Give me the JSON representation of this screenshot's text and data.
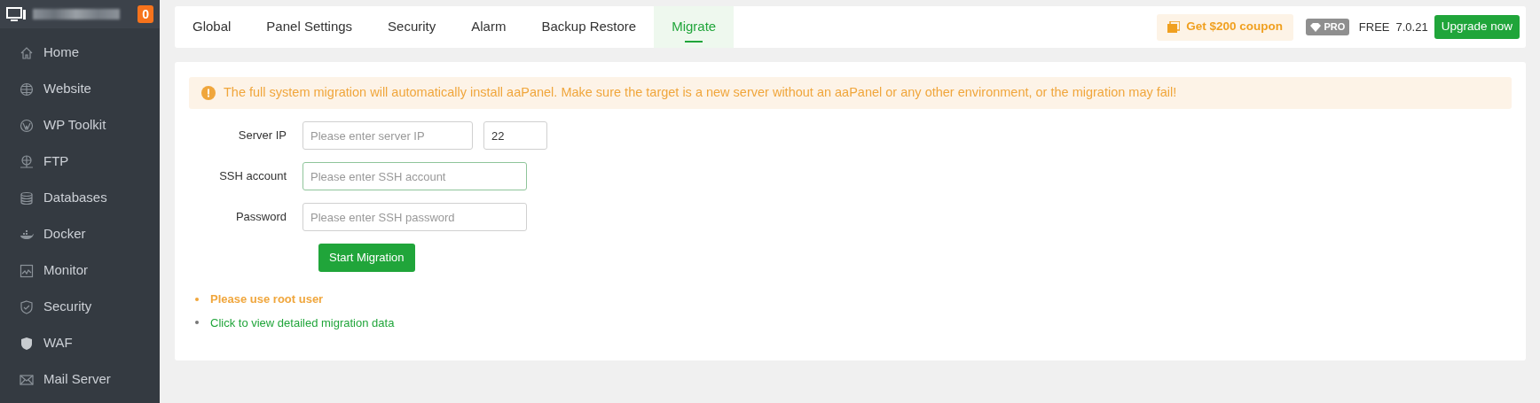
{
  "sidebar": {
    "badge": "0",
    "items": [
      {
        "label": "Home"
      },
      {
        "label": "Website"
      },
      {
        "label": "WP Toolkit"
      },
      {
        "label": "FTP"
      },
      {
        "label": "Databases"
      },
      {
        "label": "Docker"
      },
      {
        "label": "Monitor"
      },
      {
        "label": "Security"
      },
      {
        "label": "WAF"
      },
      {
        "label": "Mail Server"
      }
    ]
  },
  "tabs": [
    {
      "label": "Global",
      "selected": false
    },
    {
      "label": "Panel Settings",
      "selected": false
    },
    {
      "label": "Security",
      "selected": false
    },
    {
      "label": "Alarm",
      "selected": false
    },
    {
      "label": "Backup Restore",
      "selected": false
    },
    {
      "label": "Migrate",
      "selected": true
    }
  ],
  "header": {
    "coupon": "Get $200 coupon",
    "pro": "PRO",
    "plan": "FREE",
    "version": "7.0.21",
    "upgrade": "Upgrade now"
  },
  "alert": "The full system migration will automatically install aaPanel. Make sure the target is a new server without an aaPanel or any other environment, or the migration may fail!",
  "form": {
    "rows": [
      {
        "label": "Server IP",
        "fields": [
          {
            "placeholder": "Please enter server IP",
            "focused": false
          },
          {
            "value": "22",
            "focused": false
          }
        ]
      },
      {
        "label": "SSH account",
        "fields": [
          {
            "placeholder": "Please enter SSH account",
            "focused": true
          }
        ]
      },
      {
        "label": "Password",
        "fields": [
          {
            "placeholder": "Please enter SSH password",
            "focused": false
          }
        ]
      }
    ],
    "button": "Start Migration"
  },
  "notes": [
    {
      "kind": "warning",
      "text": "Please use root user"
    },
    {
      "kind": "link",
      "text": "Click to view detailed migration data"
    }
  ]
}
